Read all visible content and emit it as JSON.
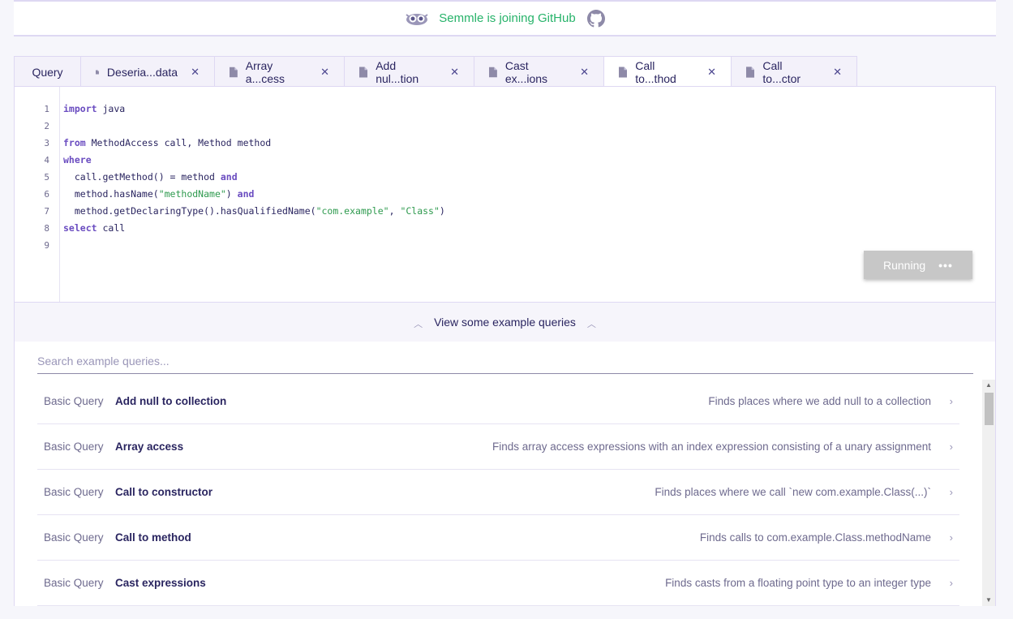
{
  "banner": {
    "text": "Semmle is joining GitHub",
    "owl_icon": "owl-icon",
    "github_icon": "github-icon"
  },
  "tabs": [
    {
      "label": "Query",
      "closable": false,
      "active": false
    },
    {
      "label": "Deseria...data",
      "closable": true,
      "active": false
    },
    {
      "label": "Array a...cess",
      "closable": true,
      "active": false
    },
    {
      "label": "Add nul...tion",
      "closable": true,
      "active": false
    },
    {
      "label": "Cast ex...ions",
      "closable": true,
      "active": false
    },
    {
      "label": "Call to...thod",
      "closable": true,
      "active": true
    },
    {
      "label": "Call to...ctor",
      "closable": true,
      "active": false
    }
  ],
  "close_glyph": "✕",
  "editor": {
    "line_numbers": [
      "1",
      "2",
      "3",
      "4",
      "5",
      "6",
      "7",
      "8",
      "9"
    ],
    "lines": [
      [
        {
          "t": "import",
          "k": "kw"
        },
        {
          "t": " java"
        }
      ],
      [],
      [
        {
          "t": "from",
          "k": "kw"
        },
        {
          "t": " MethodAccess call, Method method"
        }
      ],
      [
        {
          "t": "where",
          "k": "kw"
        }
      ],
      [
        {
          "t": "  call.getMethod() = method "
        },
        {
          "t": "and",
          "k": "kw"
        }
      ],
      [
        {
          "t": "  method.hasName("
        },
        {
          "t": "\"methodName\"",
          "k": "str"
        },
        {
          "t": ") "
        },
        {
          "t": "and",
          "k": "kw"
        }
      ],
      [
        {
          "t": "  method.getDeclaringType().hasQualifiedName("
        },
        {
          "t": "\"com.example\"",
          "k": "str"
        },
        {
          "t": ", "
        },
        {
          "t": "\"Class\"",
          "k": "str"
        },
        {
          "t": ")"
        }
      ],
      [
        {
          "t": "select",
          "k": "kw"
        },
        {
          "t": " call"
        }
      ],
      []
    ],
    "run_button": {
      "label": "Running",
      "dots": "•••"
    }
  },
  "examples": {
    "toggle_label": "View some example queries",
    "search_placeholder": "Search example queries...",
    "items": [
      {
        "category": "Basic Query",
        "name": "Add null to collection",
        "description": "Finds places where we add null to a collection"
      },
      {
        "category": "Basic Query",
        "name": "Array access",
        "description": "Finds array access expressions with an index expression consisting of a unary assignment"
      },
      {
        "category": "Basic Query",
        "name": "Call to constructor",
        "description": "Finds places where we call `new com.example.Class(...)`"
      },
      {
        "category": "Basic Query",
        "name": "Call to method",
        "description": "Finds calls to com.example.Class.methodName"
      },
      {
        "category": "Basic Query",
        "name": "Cast expressions",
        "description": "Finds casts from a floating point type to an integer type"
      }
    ],
    "arrow_glyph": "›"
  },
  "colors": {
    "accent_green": "#27b36a",
    "text_primary": "#2a2560",
    "keyword": "#6a4cc0",
    "string": "#2e9a4e",
    "border": "#ded8f3"
  }
}
